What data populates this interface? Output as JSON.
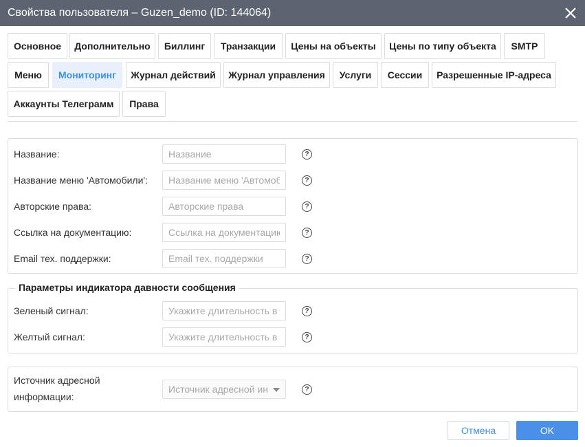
{
  "window": {
    "title": "Свойства пользователя – Guzen_demo (ID: 144064)",
    "close_icon": "close-icon"
  },
  "tabs": [
    {
      "label": "Основное"
    },
    {
      "label": "Дополнительно"
    },
    {
      "label": "Биллинг"
    },
    {
      "label": "Транзакции"
    },
    {
      "label": "Цены на объекты"
    },
    {
      "label": "Цены по типу объекта"
    },
    {
      "label": "SMTP"
    },
    {
      "label": "Меню"
    },
    {
      "label": "Мониторинг",
      "active": true
    },
    {
      "label": "Журнал действий"
    },
    {
      "label": "Журнал управления"
    },
    {
      "label": "Услуги"
    },
    {
      "label": "Сессии"
    },
    {
      "label": "Разрешенные IP-адреса"
    },
    {
      "label": "Аккаунты Телеграмм"
    },
    {
      "label": "Права"
    }
  ],
  "general": {
    "fields": [
      {
        "label": "Название:",
        "placeholder": "Название",
        "value": ""
      },
      {
        "label": "Название меню 'Автомобили':",
        "placeholder": "Название меню 'Автомобили'",
        "value": ""
      },
      {
        "label": "Авторские права:",
        "placeholder": "Авторские права",
        "value": ""
      },
      {
        "label": "Ссылка на документацию:",
        "placeholder": "Ссылка на документацию",
        "value": ""
      },
      {
        "label": "Email тех. поддержки:",
        "placeholder": "Email тех. поддержки",
        "value": ""
      }
    ]
  },
  "indicator": {
    "legend": "Параметры индикатора давности сообщения",
    "fields": [
      {
        "label": "Зеленый сигнал:",
        "placeholder": "Укажите длительность в",
        "value": ""
      },
      {
        "label": "Желтый сигнал:",
        "placeholder": "Укажите длительность в",
        "value": ""
      }
    ]
  },
  "address": {
    "label_line1": "Источник адресной",
    "label_line2": "информации:",
    "select_placeholder": "Источник адресной информации"
  },
  "help_glyph": "?",
  "buttons": {
    "cancel": "Отмена",
    "ok": "OK"
  },
  "colors": {
    "titlebar": "#5b6470",
    "accent": "#4a90e8",
    "active_tab_bg": "#e8f0fb",
    "active_tab_text": "#3f8fe0"
  }
}
